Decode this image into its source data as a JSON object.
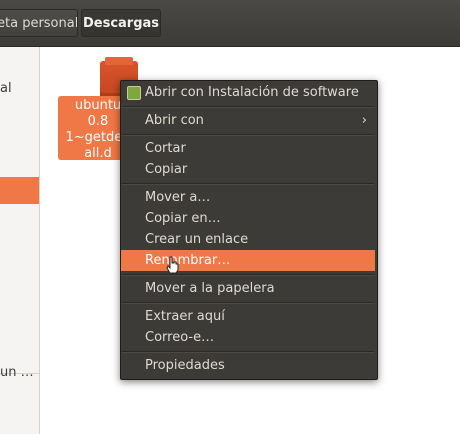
{
  "pathbar": {
    "home_label": "eta personal",
    "current_label": "Descargas"
  },
  "sidebar": {
    "items": [
      {
        "label": "al"
      },
      {
        "label": "un …"
      }
    ]
  },
  "file": {
    "label_lines": [
      "ubuntu",
      "0.8",
      "1~getdeb",
      "all.d"
    ],
    "icon": "package-icon"
  },
  "menu": {
    "items": [
      {
        "label": "Abrir con Instalación de software",
        "icon": "software-center-icon"
      },
      {
        "label": "Abrir con",
        "submenu_icon": "chevron-right-icon"
      },
      {
        "label": "Cortar"
      },
      {
        "label": "Copiar"
      },
      {
        "label": "Mover a…"
      },
      {
        "label": "Copiar en…"
      },
      {
        "label": "Crear un enlace"
      },
      {
        "label": "Renombrar…",
        "highlighted": true
      },
      {
        "label": "Mover a la papelera"
      },
      {
        "label": "Extraer aquí"
      },
      {
        "label": "Correo-e…"
      },
      {
        "label": "Propiedades"
      }
    ]
  },
  "colors": {
    "accent": "#f07746",
    "menu_bg": "#3c3b37",
    "toolbar_bg": "#3c3b37"
  }
}
